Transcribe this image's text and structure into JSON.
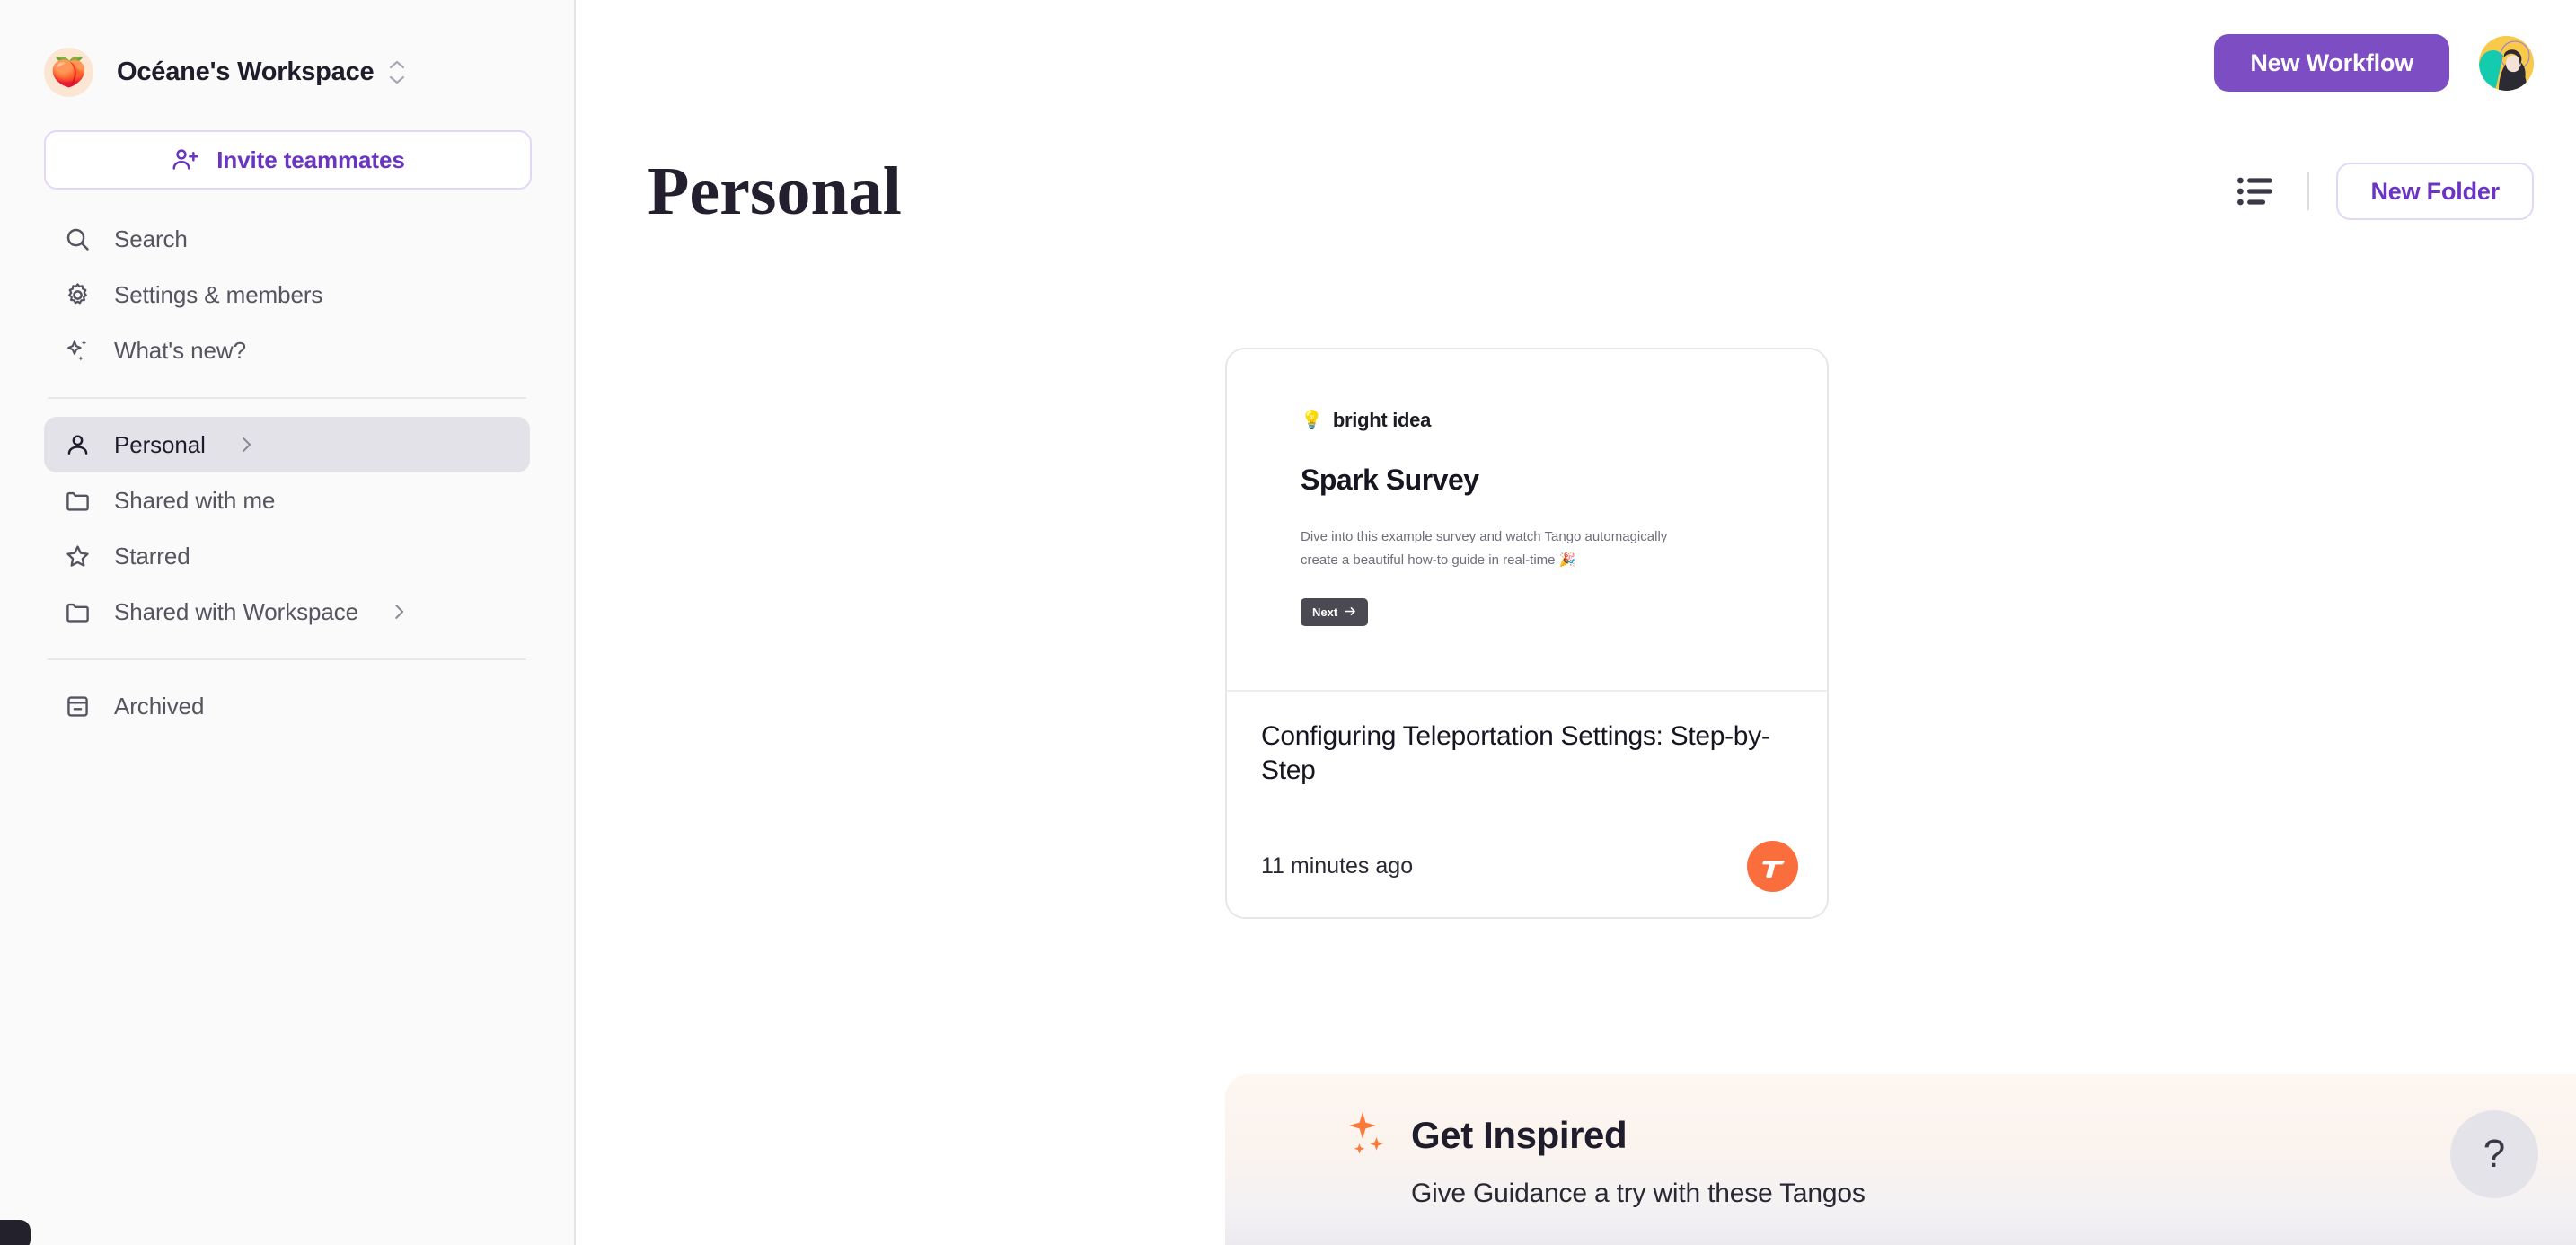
{
  "workspace": {
    "name": "Océane's Workspace",
    "avatar_icon": "peach-emoji",
    "switcher_icon": "chevron-up-down-icon",
    "invite_label": "Invite teammates",
    "invite_icon": "user-plus-icon"
  },
  "sidebar": {
    "top_items": [
      {
        "label": "Search",
        "icon": "search-icon"
      },
      {
        "label": "Settings & members",
        "icon": "gear-icon"
      },
      {
        "label": "What's new?",
        "icon": "sparkles-icon"
      }
    ],
    "folder_items": [
      {
        "label": "Personal",
        "icon": "person-icon",
        "active": true,
        "chevron": true
      },
      {
        "label": "Shared with me",
        "icon": "folder-icon",
        "active": false,
        "chevron": false
      },
      {
        "label": "Starred",
        "icon": "star-icon",
        "active": false,
        "chevron": false
      },
      {
        "label": "Shared with Workspace",
        "icon": "folder-icon",
        "active": false,
        "chevron": true
      }
    ],
    "archived": {
      "label": "Archived",
      "icon": "archive-icon"
    }
  },
  "topbar": {
    "new_workflow_label": "New Workflow",
    "avatar_name": "user-avatar"
  },
  "page": {
    "title": "Personal",
    "view_toggle_icon": "list-view-icon",
    "new_folder_label": "New Folder"
  },
  "card": {
    "thumbnail": {
      "brand_icon": "lightbulb-emoji",
      "brand_name": "bright idea",
      "heading": "Spark Survey",
      "body": "Dive into this example survey and watch Tango automagically create a beautiful how-to guide in real-time 🎉",
      "next_label": "Next",
      "next_icon": "arrow-right-icon"
    },
    "title": "Configuring Teleportation Settings: Step-by-Step",
    "timestamp": "11 minutes ago",
    "badge_icon": "tango-logo-icon"
  },
  "inspired": {
    "icon": "sparkle-orange-icon",
    "title": "Get Inspired",
    "subtitle": "Give Guidance a try with these Tangos",
    "collapse_icon": "chevron-down-icon"
  },
  "help": {
    "label": "?",
    "icon": "question-mark-icon"
  },
  "colors": {
    "accent_purple": "#7d4dc4",
    "accent_purple_text": "#6b35c4",
    "tango_orange": "#fa6d3c",
    "sidebar_bg": "#fafafa",
    "active_item_bg": "#e4e2e9",
    "inspired_bg": "#fdf6f1"
  }
}
